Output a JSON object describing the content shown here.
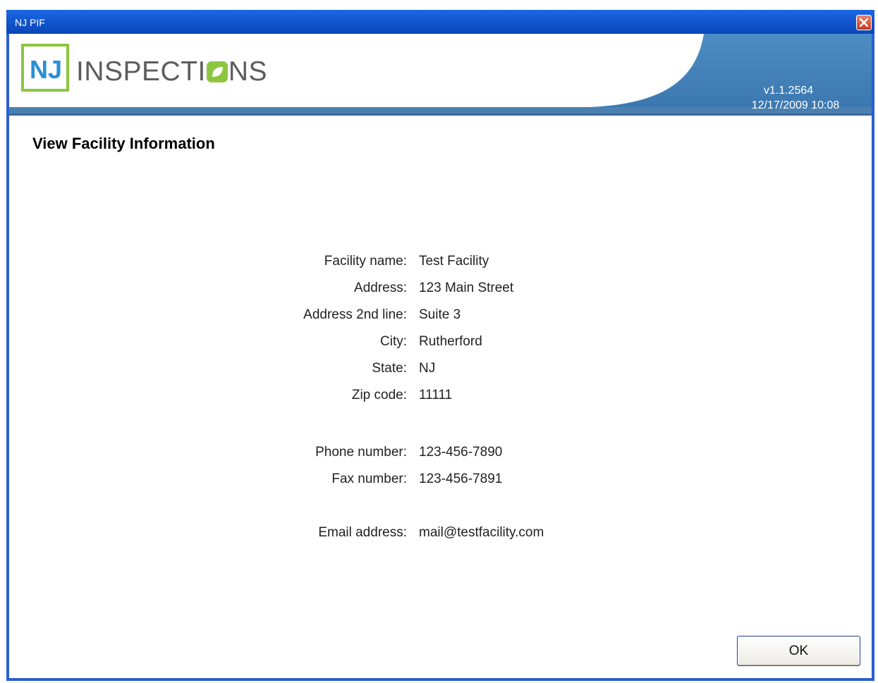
{
  "window": {
    "title": "NJ PIF"
  },
  "banner": {
    "logo_letters": "NJ",
    "logo_word": "INSPECTIONS",
    "version": "v1.1.2564",
    "datetime": "12/17/2009 10:08"
  },
  "page": {
    "title": "View Facility Information"
  },
  "facility": {
    "fields": [
      {
        "label": "Facility name:",
        "value": "Test Facility"
      },
      {
        "label": "Address:",
        "value": "123 Main Street"
      },
      {
        "label": "Address 2nd line:",
        "value": "Suite 3"
      },
      {
        "label": "City:",
        "value": "Rutherford"
      },
      {
        "label": "State:",
        "value": "NJ"
      },
      {
        "label": "Zip code:",
        "value": "11111"
      },
      {
        "label": "Phone number:",
        "value": "123-456-7890"
      },
      {
        "label": "Fax number:",
        "value": "123-456-7891"
      },
      {
        "label": "Email address:",
        "value": "mail@testfacility.com"
      }
    ]
  },
  "actions": {
    "ok_label": "OK"
  },
  "colors": {
    "titlebar": "#1356d0",
    "banner_blue": "#3f7fb8",
    "logo_green": "#8cc63f",
    "logo_blue": "#2a8fd3"
  },
  "icons": {
    "close": "close-icon",
    "leaf": "leaf-icon"
  }
}
